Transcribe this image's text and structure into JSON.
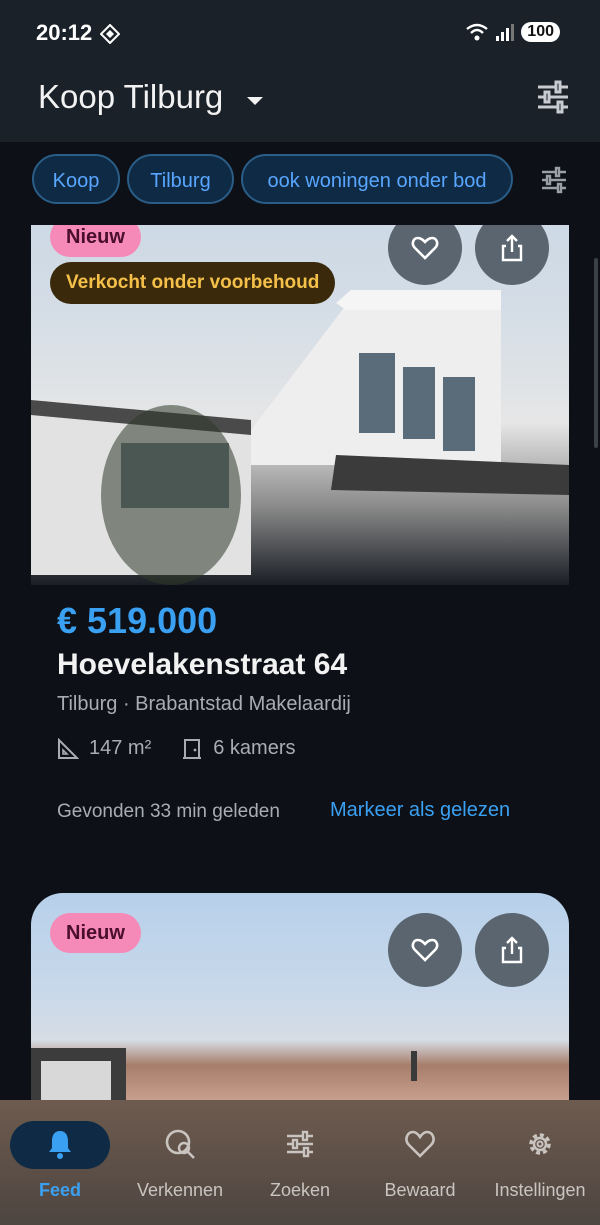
{
  "status": {
    "time": "20:12",
    "battery": "100"
  },
  "appbar": {
    "title": "Koop Tilburg"
  },
  "chips": [
    "Koop",
    "Tilburg",
    "ook woningen onder bod"
  ],
  "listing1": {
    "badge_new": "Nieuw",
    "badge_status": "Verkocht onder voorbehoud",
    "price": "€ 519.000",
    "address": "Hoevelakenstraat 64",
    "subline": "Tilburg · Brabantstad Makelaardij",
    "area": "147 m²",
    "rooms": "6 kamers",
    "found": "Gevonden 33 min geleden",
    "mark_read": "Markeer als gelezen"
  },
  "listing2": {
    "badge_new": "Nieuw"
  },
  "nav": {
    "items": [
      {
        "label": "Feed",
        "icon": "bell-icon",
        "active": true
      },
      {
        "label": "Verkennen",
        "icon": "explore-icon",
        "active": false
      },
      {
        "label": "Zoeken",
        "icon": "tune-icon",
        "active": false
      },
      {
        "label": "Bewaard",
        "icon": "heart-icon",
        "active": false
      },
      {
        "label": "Instellingen",
        "icon": "gear-icon",
        "active": false
      }
    ]
  },
  "colors": {
    "accent": "#3aa0f2",
    "background": "#0d1117",
    "new_badge": "#f58ab8",
    "status_badge_text": "#f5c04a"
  }
}
